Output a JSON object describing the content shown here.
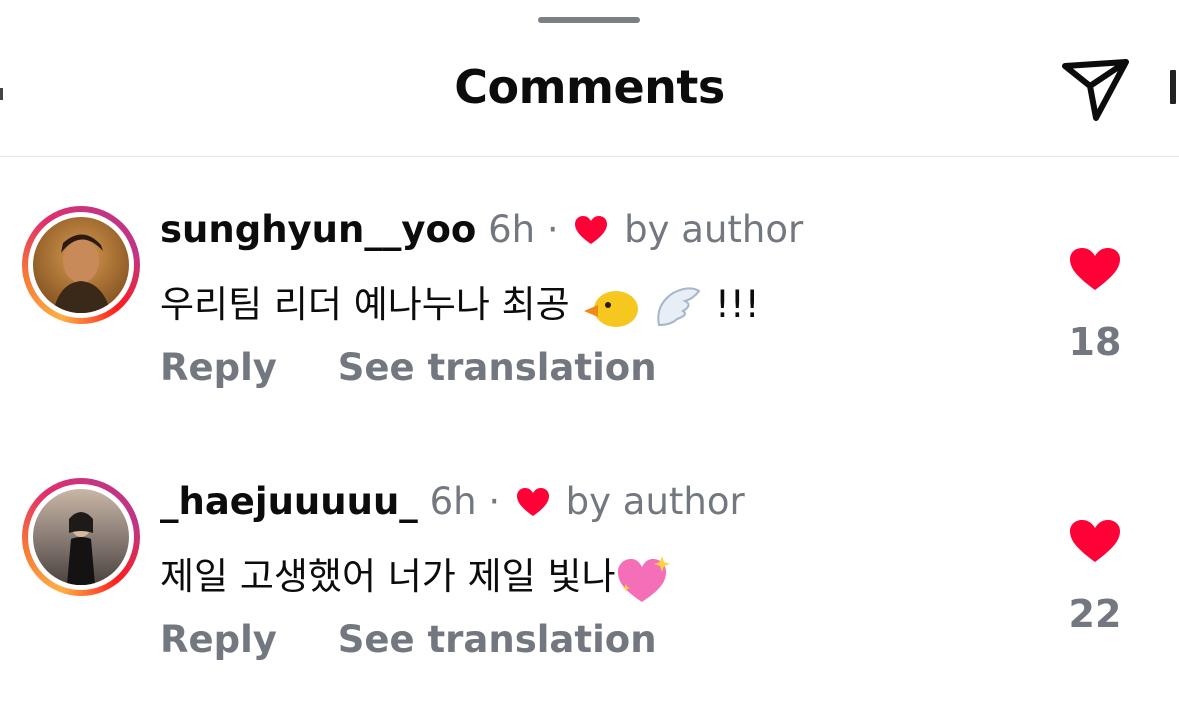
{
  "header": {
    "title": "Comments"
  },
  "comments": [
    {
      "username": "sunghyun__yoo",
      "time": "6h",
      "separator": "·",
      "author_like_text": "by author",
      "text": "우리팀 리더 예나누나 최공",
      "text_suffix": "!!!",
      "emojis": [
        "duck-emoji",
        "wing-emoji"
      ],
      "reply_label": "Reply",
      "translate_label": "See translation",
      "like_count": "18"
    },
    {
      "username": "_haejuuuuu_",
      "time": "6h",
      "separator": "·",
      "author_like_text": "by author",
      "text": "제일 고생했어 너가 제일 빛나",
      "text_suffix": "",
      "emojis": [
        "sparkling-heart-emoji"
      ],
      "reply_label": "Reply",
      "translate_label": "See translation",
      "like_count": "22"
    }
  ],
  "colors": {
    "like_red": "#ff0136",
    "muted_gray": "#737880",
    "ring_pink": "#e1306c",
    "ring_orange": "#fcaf45"
  }
}
